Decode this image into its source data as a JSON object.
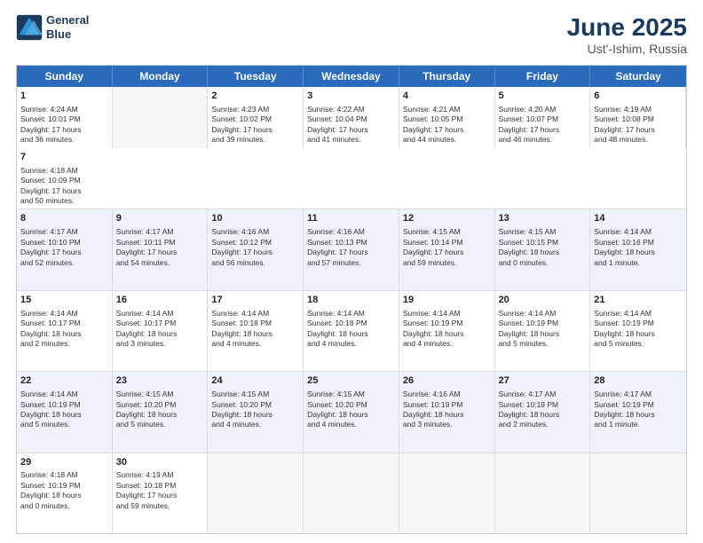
{
  "header": {
    "logo_line1": "General",
    "logo_line2": "Blue",
    "month": "June 2025",
    "location": "Ust'-Ishim, Russia"
  },
  "weekdays": [
    "Sunday",
    "Monday",
    "Tuesday",
    "Wednesday",
    "Thursday",
    "Friday",
    "Saturday"
  ],
  "rows": [
    [
      {
        "day": "",
        "info": ""
      },
      {
        "day": "2",
        "info": "Sunrise: 4:23 AM\nSunset: 10:02 PM\nDaylight: 17 hours\nand 39 minutes."
      },
      {
        "day": "3",
        "info": "Sunrise: 4:22 AM\nSunset: 10:04 PM\nDaylight: 17 hours\nand 41 minutes."
      },
      {
        "day": "4",
        "info": "Sunrise: 4:21 AM\nSunset: 10:05 PM\nDaylight: 17 hours\nand 44 minutes."
      },
      {
        "day": "5",
        "info": "Sunrise: 4:20 AM\nSunset: 10:07 PM\nDaylight: 17 hours\nand 46 minutes."
      },
      {
        "day": "6",
        "info": "Sunrise: 4:19 AM\nSunset: 10:08 PM\nDaylight: 17 hours\nand 48 minutes."
      },
      {
        "day": "7",
        "info": "Sunrise: 4:18 AM\nSunset: 10:09 PM\nDaylight: 17 hours\nand 50 minutes."
      }
    ],
    [
      {
        "day": "8",
        "info": "Sunrise: 4:17 AM\nSunset: 10:10 PM\nDaylight: 17 hours\nand 52 minutes."
      },
      {
        "day": "9",
        "info": "Sunrise: 4:17 AM\nSunset: 10:11 PM\nDaylight: 17 hours\nand 54 minutes."
      },
      {
        "day": "10",
        "info": "Sunrise: 4:16 AM\nSunset: 10:12 PM\nDaylight: 17 hours\nand 56 minutes."
      },
      {
        "day": "11",
        "info": "Sunrise: 4:16 AM\nSunset: 10:13 PM\nDaylight: 17 hours\nand 57 minutes."
      },
      {
        "day": "12",
        "info": "Sunrise: 4:15 AM\nSunset: 10:14 PM\nDaylight: 17 hours\nand 59 minutes."
      },
      {
        "day": "13",
        "info": "Sunrise: 4:15 AM\nSunset: 10:15 PM\nDaylight: 18 hours\nand 0 minutes."
      },
      {
        "day": "14",
        "info": "Sunrise: 4:14 AM\nSunset: 10:16 PM\nDaylight: 18 hours\nand 1 minute."
      }
    ],
    [
      {
        "day": "15",
        "info": "Sunrise: 4:14 AM\nSunset: 10:17 PM\nDaylight: 18 hours\nand 2 minutes."
      },
      {
        "day": "16",
        "info": "Sunrise: 4:14 AM\nSunset: 10:17 PM\nDaylight: 18 hours\nand 3 minutes."
      },
      {
        "day": "17",
        "info": "Sunrise: 4:14 AM\nSunset: 10:18 PM\nDaylight: 18 hours\nand 4 minutes."
      },
      {
        "day": "18",
        "info": "Sunrise: 4:14 AM\nSunset: 10:18 PM\nDaylight: 18 hours\nand 4 minutes."
      },
      {
        "day": "19",
        "info": "Sunrise: 4:14 AM\nSunset: 10:19 PM\nDaylight: 18 hours\nand 4 minutes."
      },
      {
        "day": "20",
        "info": "Sunrise: 4:14 AM\nSunset: 10:19 PM\nDaylight: 18 hours\nand 5 minutes."
      },
      {
        "day": "21",
        "info": "Sunrise: 4:14 AM\nSunset: 10:19 PM\nDaylight: 18 hours\nand 5 minutes."
      }
    ],
    [
      {
        "day": "22",
        "info": "Sunrise: 4:14 AM\nSunset: 10:19 PM\nDaylight: 18 hours\nand 5 minutes."
      },
      {
        "day": "23",
        "info": "Sunrise: 4:15 AM\nSunset: 10:20 PM\nDaylight: 18 hours\nand 5 minutes."
      },
      {
        "day": "24",
        "info": "Sunrise: 4:15 AM\nSunset: 10:20 PM\nDaylight: 18 hours\nand 4 minutes."
      },
      {
        "day": "25",
        "info": "Sunrise: 4:15 AM\nSunset: 10:20 PM\nDaylight: 18 hours\nand 4 minutes."
      },
      {
        "day": "26",
        "info": "Sunrise: 4:16 AM\nSunset: 10:19 PM\nDaylight: 18 hours\nand 3 minutes."
      },
      {
        "day": "27",
        "info": "Sunrise: 4:17 AM\nSunset: 10:19 PM\nDaylight: 18 hours\nand 2 minutes."
      },
      {
        "day": "28",
        "info": "Sunrise: 4:17 AM\nSunset: 10:19 PM\nDaylight: 18 hours\nand 1 minute."
      }
    ],
    [
      {
        "day": "29",
        "info": "Sunrise: 4:18 AM\nSunset: 10:19 PM\nDaylight: 18 hours\nand 0 minutes."
      },
      {
        "day": "30",
        "info": "Sunrise: 4:19 AM\nSunset: 10:18 PM\nDaylight: 17 hours\nand 59 minutes."
      },
      {
        "day": "",
        "info": ""
      },
      {
        "day": "",
        "info": ""
      },
      {
        "day": "",
        "info": ""
      },
      {
        "day": "",
        "info": ""
      },
      {
        "day": "",
        "info": ""
      }
    ]
  ],
  "row0_day1": {
    "day": "1",
    "info": "Sunrise: 4:24 AM\nSunset: 10:01 PM\nDaylight: 17 hours\nand 36 minutes."
  }
}
